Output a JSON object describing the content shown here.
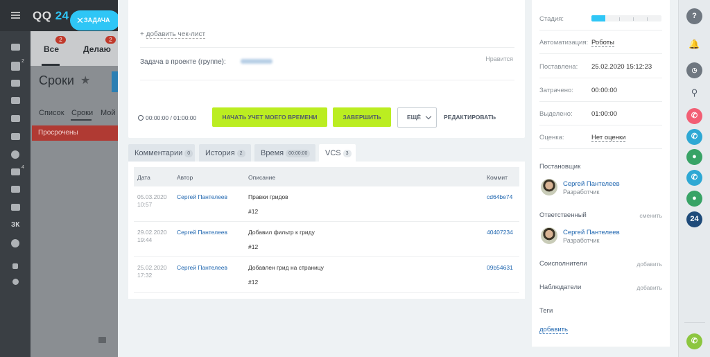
{
  "app": {
    "logo_text": "QQ",
    "logo_num": "24",
    "task_button": "ЗАДАЧА",
    "left_nav_badge_tasks": "2",
    "left_nav_badge_filter": "4",
    "left_nav_3k": "ЗК"
  },
  "list_view": {
    "tabs": [
      {
        "label": "Все",
        "badge": "2"
      },
      {
        "label": "Делаю",
        "badge": "2"
      }
    ],
    "title": "Сроки",
    "subtabs": [
      "Список",
      "Сроки",
      "Мой"
    ],
    "overdue": "Просрочены"
  },
  "task": {
    "add_checklist": "добавить чек-лист",
    "project_label": "Задача в проекте (группе):",
    "like": "Нравится",
    "timer": "00:00:00 / 01:00:00",
    "start_timer_button": "НАЧАТЬ УЧЕТ МОЕГО ВРЕМЕНИ",
    "finish_button": "ЗАВЕРШИТЬ",
    "more_button": "ЕЩЁ",
    "edit_button": "РЕДАКТИРОВАТЬ"
  },
  "tabs": [
    {
      "label": "Комментарии",
      "count": "0"
    },
    {
      "label": "История",
      "count": "2"
    },
    {
      "label": "Время",
      "count": "00:00:00"
    },
    {
      "label": "VCS",
      "count": "3"
    }
  ],
  "vcs_table": {
    "headers": {
      "date": "Дата",
      "author": "Автор",
      "description": "Описание",
      "commit": "Коммит"
    },
    "rows": [
      {
        "date": "05.03.2020",
        "time": "10:57",
        "author": "Сергей Пантелеев",
        "description": "Правки гридов",
        "tag": "#12",
        "commit": "cd64be74"
      },
      {
        "date": "29.02.2020",
        "time": "19:44",
        "author": "Сергей Пантелеев",
        "description": "Добавил фильтр к гриду",
        "tag": "#12",
        "commit": "40407234"
      },
      {
        "date": "25.02.2020",
        "time": "17:32",
        "author": "Сергей Пантелеев",
        "description": "Добавлен грид на страницу",
        "tag": "#12",
        "commit": "09b54631"
      }
    ]
  },
  "sidebar": {
    "stage_label": "Стадия:",
    "stage_progress": 0.2,
    "automation_label": "Автоматизация:",
    "automation_value": "Роботы",
    "created_label": "Поставлена:",
    "created_value": "25.02.2020 15:12:23",
    "spent_label": "Затрачено:",
    "spent_value": "00:00:00",
    "allotted_label": "Выделено:",
    "allotted_value": "01:00:00",
    "rating_label": "Оценка:",
    "rating_value": "Нет оценки",
    "creator_label": "Постановщик",
    "creator_name": "Сергей Пантелеев",
    "creator_role": "Разработчик",
    "responsible_label": "Ответственный",
    "responsible_change": "сменить",
    "responsible_name": "Сергей Пантелеев",
    "responsible_role": "Разработчик",
    "coexecutors_label": "Соисполнители",
    "coexecutors_add": "добавить",
    "observers_label": "Наблюдатели",
    "observers_add": "добавить",
    "tags_label": "Теги",
    "tags_add": "добавить"
  },
  "rail": {
    "help": "?",
    "badge_24": "24"
  }
}
